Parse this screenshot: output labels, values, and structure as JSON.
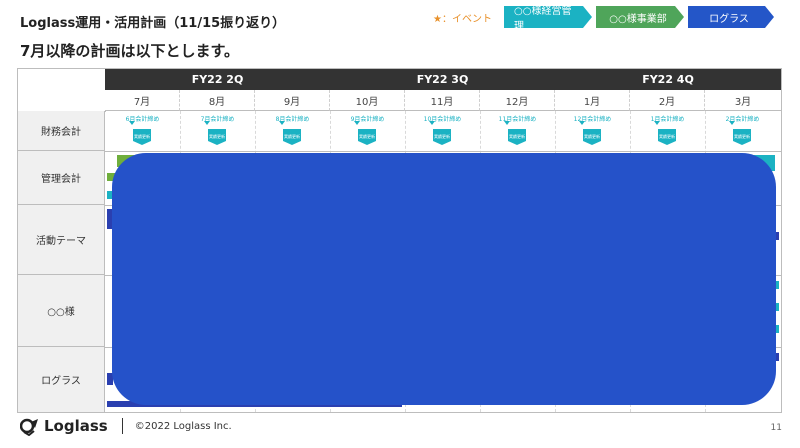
{
  "header": {
    "title": "Loglass運用・活用計画（11/15振り返り）",
    "subtitle": "7月以降の計画は以下とします。"
  },
  "legend": {
    "event": "★：イベント",
    "chips": [
      {
        "label": "○○様経営管理",
        "color": "#1bb2c3"
      },
      {
        "label": "○○様事業部",
        "color": "#4fa55a"
      },
      {
        "label": "ログラス",
        "color": "#2456c8"
      }
    ]
  },
  "table": {
    "quarters": [
      "FY22 2Q",
      "FY22 3Q",
      "FY22 4Q"
    ],
    "months": [
      "7月",
      "8月",
      "9月",
      "10月",
      "11月",
      "12月",
      "1月",
      "2月",
      "3月"
    ],
    "rows": [
      "財務会計",
      "管理会計",
      "活動テーマ",
      "○○様",
      "ログラス"
    ],
    "finance_events": [
      "6月会計締め",
      "7月会計締め",
      "8月会計締め",
      "9月会計締め",
      "10月会計締め",
      "11月会計締め",
      "12月会計締め",
      "1月会計締め",
      "2月会計締め"
    ],
    "finance_badge": "実績更新"
  },
  "footer": {
    "logo": "Loglass",
    "copyright": "©2022 Loglass Inc.",
    "page": "11"
  }
}
